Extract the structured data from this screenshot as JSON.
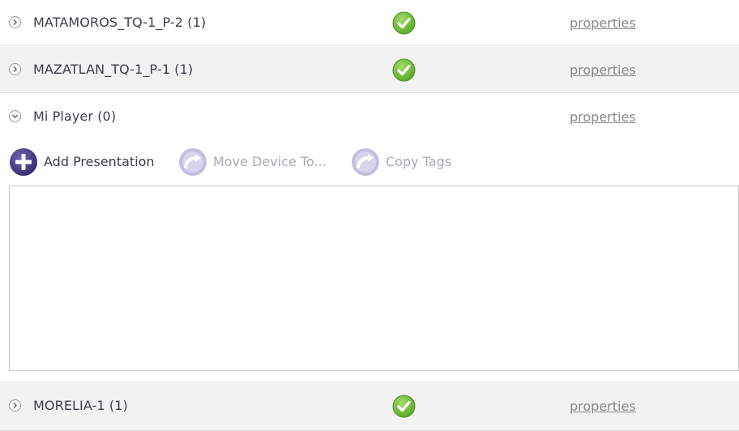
{
  "devices": [
    {
      "name": "MATAMOROS_TQ-1_P-2 (1)",
      "status_icon": "green-check-icon",
      "properties_label": "properties"
    },
    {
      "name": "MAZATLAN_TQ-1_P-1 (1)",
      "status_icon": "green-check-icon",
      "properties_label": "properties"
    },
    {
      "name": "Mi Player (0)",
      "properties_label": "properties",
      "expanded": true
    },
    {
      "name": "MORELIA-1 (1)",
      "status_icon": "green-check-icon",
      "properties_label": "properties"
    }
  ],
  "toolbar": {
    "add_presentation_label": "Add Presentation",
    "move_device_label": "Move Device To...",
    "copy_tags_label": "Copy Tags"
  },
  "colors": {
    "accent_purple": "#4b3f8c",
    "disabled_purple": "#b9b4d6",
    "status_green": "#7cc242",
    "row_shade": "#f2f2f2"
  }
}
